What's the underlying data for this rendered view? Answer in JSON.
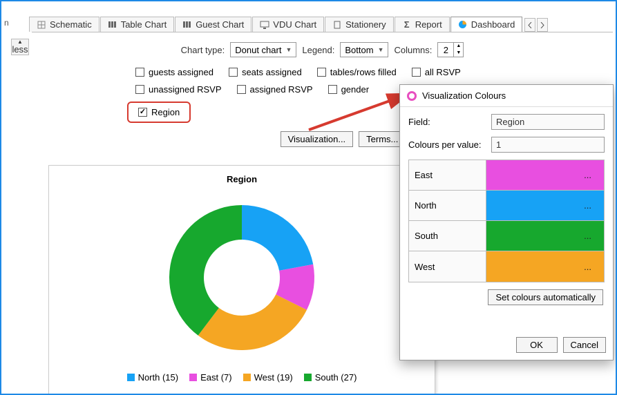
{
  "tabs": {
    "schematic": "Schematic",
    "table_chart": "Table Chart",
    "guest_chart": "Guest Chart",
    "vdu_chart": "VDU Chart",
    "stationery": "Stationery",
    "report": "Report",
    "dashboard": "Dashboard"
  },
  "less_button": "less",
  "controls": {
    "chart_type_label": "Chart type:",
    "chart_type_value": "Donut chart",
    "legend_label": "Legend:",
    "legend_value": "Bottom",
    "columns_label": "Columns:",
    "columns_value": "2"
  },
  "checkboxes": {
    "guests_assigned": "guests assigned",
    "seats_assigned": "seats assigned",
    "tables_rows_filled": "tables/rows filled",
    "all_rsvp": "all RSVP",
    "unassigned_rsvp": "unassigned RSVP",
    "assigned_rsvp": "assigned RSVP",
    "gender": "gender",
    "region": "Region"
  },
  "buttons": {
    "visualization": "Visualization...",
    "terms": "Terms..."
  },
  "chart": {
    "title": "Region",
    "legend": {
      "north": "North (15)",
      "east": "East (7)",
      "west": "West (19)",
      "south": "South (27)"
    },
    "colors": {
      "north": "#17a2f5",
      "east": "#e84fe0",
      "west": "#f5a623",
      "south": "#17a82e"
    }
  },
  "dialog": {
    "title": "Visualization Colours",
    "field_label": "Field:",
    "field_value": "Region",
    "cpv_label": "Colours per value:",
    "cpv_value": "1",
    "rows": {
      "east": "East",
      "north": "North",
      "south": "South",
      "west": "West"
    },
    "ellipsis": "...",
    "auto_btn": "Set colours automatically",
    "ok": "OK",
    "cancel": "Cancel"
  },
  "chart_data": {
    "type": "pie",
    "title": "Region",
    "categories": [
      "North",
      "East",
      "West",
      "South"
    ],
    "values": [
      15,
      7,
      19,
      27
    ],
    "colors": [
      "#17a2f5",
      "#e84fe0",
      "#f5a623",
      "#17a82e"
    ],
    "donut": true,
    "legend_position": "bottom"
  }
}
